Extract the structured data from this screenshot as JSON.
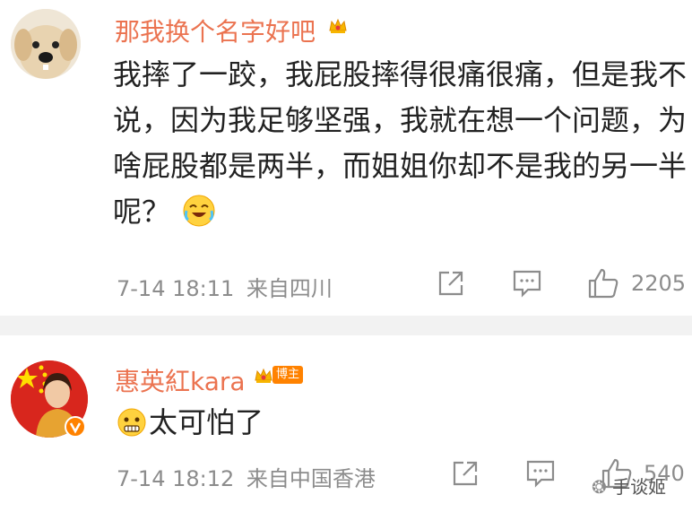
{
  "comments": [
    {
      "username": "那我换个名字好吧",
      "text": "我摔了一跤，我屁股摔得很痛很痛，但是我不说，因为我足够坚强，我就在想一个问题，为啥屁股都是两半，而姐姐你却不是我的另一半呢？",
      "time": "7-14 18:11",
      "source": "来自四川",
      "likes": "2205"
    },
    {
      "username": "惠英紅kara",
      "badge": "博主",
      "text": "太可怕了",
      "time": "7-14 18:12",
      "source": "来自中国香港",
      "likes": "540"
    }
  ],
  "watermark": "手谈姬",
  "icons": [
    "crown-icon",
    "share-icon",
    "comment-icon",
    "like-icon",
    "verified-icon",
    "emoji-crying-laugh",
    "emoji-scared"
  ],
  "colors": {
    "username": "#eb7350",
    "meta": "#8c8c8c",
    "divider": "#f2f2f2"
  }
}
